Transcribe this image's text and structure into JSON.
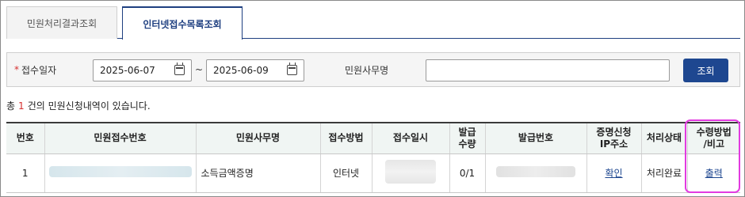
{
  "tabs": [
    {
      "label": "민원처리결과조회",
      "active": false
    },
    {
      "label": "인터넷접수목록조회",
      "active": true
    }
  ],
  "search": {
    "date_label": "접수일자",
    "required_mark": "*",
    "date_from": "2025-06-07",
    "date_to": "2025-06-09",
    "range_separator": "~",
    "office_label": "민원사무명",
    "office_value": "",
    "button_label": "조회"
  },
  "summary": {
    "prefix": "총",
    "count": "1",
    "suffix": "건의 민원신청내역이 있습니다."
  },
  "table": {
    "headers": [
      "번호",
      "민원접수번호",
      "민원사무명",
      "접수방법",
      "접수일시",
      "발급\n수량",
      "발급번호",
      "증명신청\nIP주소",
      "처리상태",
      "수령방법\n/비고"
    ],
    "rows": [
      {
        "no": "1",
        "office": "소득금액증명",
        "method": "인터넷",
        "qty": "0/1",
        "ip": "확인",
        "status": "처리완료",
        "receipt": "출력"
      }
    ]
  },
  "colors": {
    "primary": "#1e4790",
    "required": "#d63030",
    "highlight": "#e23be0",
    "header_bg": "#f0f5f3"
  },
  "icons": {
    "date_picker": "calendar-icon"
  }
}
